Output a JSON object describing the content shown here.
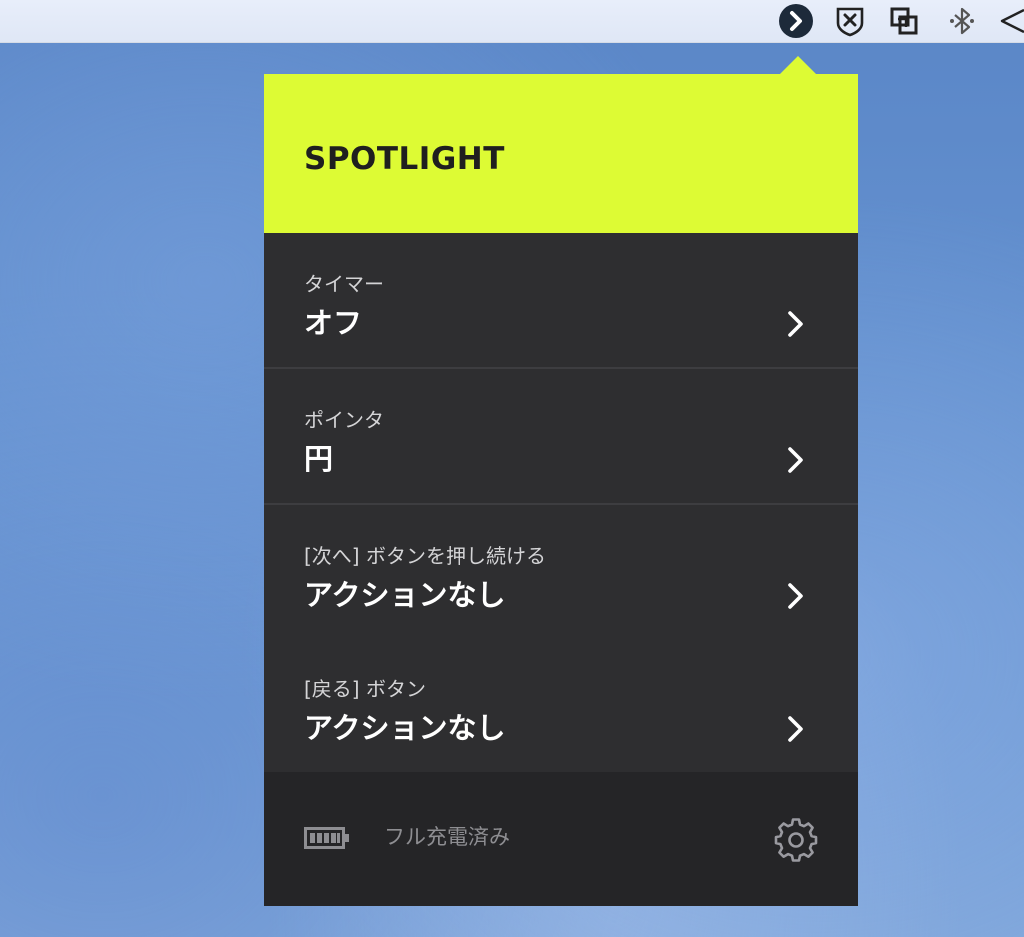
{
  "menubar": {
    "icons": [
      "logi-options-icon",
      "shield-close-icon",
      "window-switch-icon",
      "bluetooth-icon",
      "wifi-icon"
    ]
  },
  "popover": {
    "title": "SPOTLIGHT",
    "accent_color": "#ddfb34",
    "panel_color": "#2e2e30",
    "rows": [
      {
        "label": "タイマー",
        "value": "オフ"
      },
      {
        "label": "ポインタ",
        "value": "円"
      },
      {
        "label": "[次へ] ボタンを押し続ける",
        "value": "アクションなし"
      },
      {
        "label": "[戻る] ボタン",
        "value": "アクションなし"
      }
    ],
    "footer": {
      "battery_status": "フル充電済み",
      "battery_icon": "battery-full-icon",
      "settings_icon": "gear-icon"
    }
  }
}
